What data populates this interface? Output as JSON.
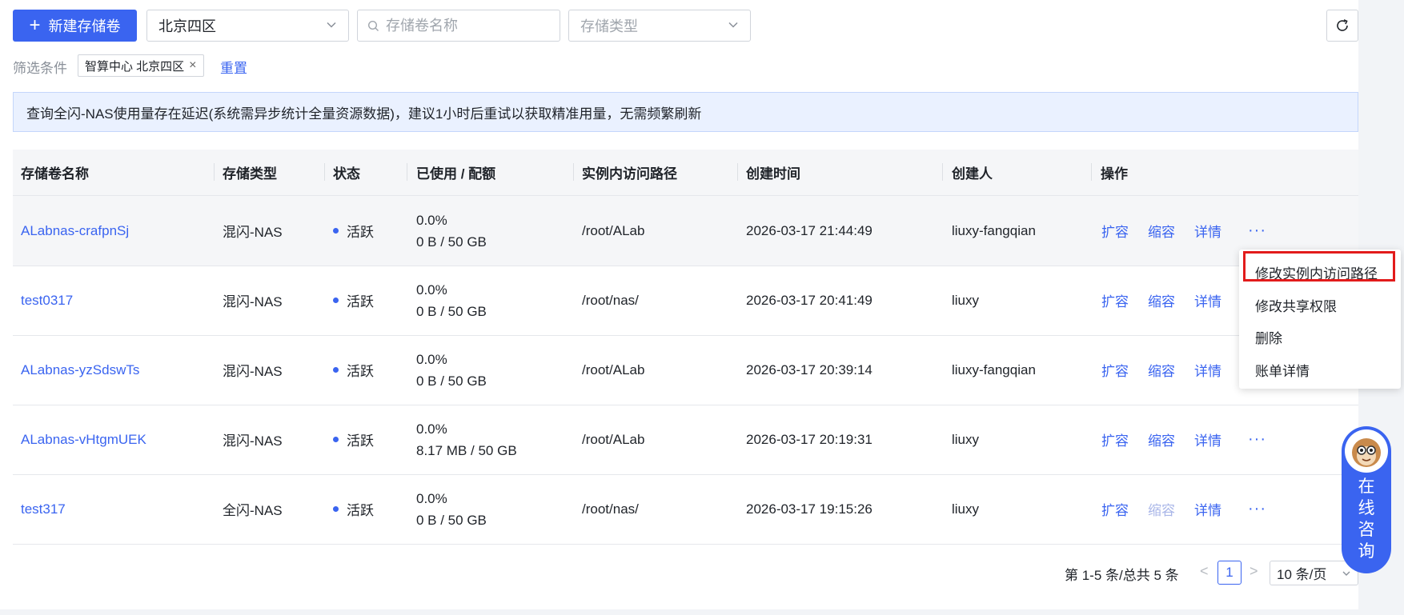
{
  "toolbar": {
    "new_button": "新建存储卷",
    "region_select": "北京四区",
    "search_placeholder": "存储卷名称",
    "type_select_placeholder": "存储类型"
  },
  "filter": {
    "label": "筛选条件",
    "tag": "智算中心 北京四区",
    "reset": "重置"
  },
  "notice": "查询全闪-NAS使用量存在延迟(系统需异步统计全量资源数据)，建议1小时后重试以获取精准用量，无需频繁刷新",
  "table": {
    "columns": [
      "存储卷名称",
      "存储类型",
      "状态",
      "已使用 / 配额",
      "实例内访问路径",
      "创建时间",
      "创建人",
      "操作"
    ],
    "rows": [
      {
        "name": "ALabnas-crafpnSj",
        "type": "混闪-NAS",
        "status": "活跃",
        "usage_pct": "0.0%",
        "usage": "0 B / 50 GB",
        "path": "/root/ALab",
        "created": "2026-03-17 21:44:49",
        "creator": "liuxy-fangqian"
      },
      {
        "name": "test0317",
        "type": "混闪-NAS",
        "status": "活跃",
        "usage_pct": "0.0%",
        "usage": "0 B / 50 GB",
        "path": "/root/nas/",
        "created": "2026-03-17 20:41:49",
        "creator": "liuxy"
      },
      {
        "name": "ALabnas-yzSdswTs",
        "type": "混闪-NAS",
        "status": "活跃",
        "usage_pct": "0.0%",
        "usage": "0 B / 50 GB",
        "path": "/root/ALab",
        "created": "2026-03-17 20:39:14",
        "creator": "liuxy-fangqian"
      },
      {
        "name": "ALabnas-vHtgmUEK",
        "type": "混闪-NAS",
        "status": "活跃",
        "usage_pct": "0.0%",
        "usage": "8.17 MB / 50 GB",
        "path": "/root/ALab",
        "created": "2026-03-17 20:19:31",
        "creator": "liuxy"
      },
      {
        "name": "test317",
        "type": "全闪-NAS",
        "status": "活跃",
        "usage_pct": "0.0%",
        "usage": "0 B / 50 GB",
        "path": "/root/nas/",
        "created": "2026-03-17 19:15:26",
        "creator": "liuxy"
      }
    ],
    "actions": {
      "expand": "扩容",
      "shrink": "缩容",
      "detail": "详情",
      "more": "···"
    }
  },
  "more_menu": {
    "items": [
      "修改实例内访问路径",
      "修改共享权限",
      "删除",
      "账单详情"
    ],
    "highlighted_item": "修改实例内访问路径",
    "highlight_color": "#e21b1b"
  },
  "pagination": {
    "total_text": "第 1-5 条/总共 5 条",
    "prev": "<",
    "current_page": "1",
    "next": ">",
    "page_size": "10 条/页"
  },
  "consult": {
    "text": "在线咨询",
    "lines": [
      "在",
      "线",
      "咨",
      "询"
    ]
  },
  "colors": {
    "accent": "#3a64f0",
    "notice_bg": "#eaf1ff",
    "header_bg": "#f5f6f8"
  }
}
